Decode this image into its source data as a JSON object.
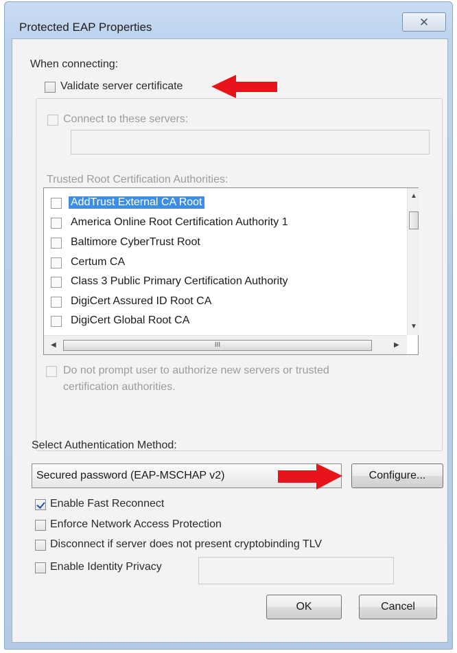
{
  "window": {
    "title": "Protected EAP Properties",
    "close_glyph": "✕"
  },
  "connecting": {
    "heading": "When connecting:",
    "validate_label": "Validate server certificate",
    "validate_checked": false,
    "connect_servers_label": "Connect to these servers:",
    "connect_servers_checked": false,
    "servers_value": ""
  },
  "trusted_root": {
    "heading": "Trusted Root Certification Authorities:",
    "items": [
      {
        "label": "AddTrust External CA Root",
        "checked": false,
        "selected": true
      },
      {
        "label": "America Online Root Certification Authority 1",
        "checked": false,
        "selected": false
      },
      {
        "label": "Baltimore CyberTrust Root",
        "checked": false,
        "selected": false
      },
      {
        "label": "Certum CA",
        "checked": false,
        "selected": false
      },
      {
        "label": "Class 3 Public Primary Certification Authority",
        "checked": false,
        "selected": false
      },
      {
        "label": "DigiCert Assured ID Root CA",
        "checked": false,
        "selected": false
      },
      {
        "label": "DigiCert Global Root CA",
        "checked": false,
        "selected": false
      }
    ],
    "hscroll_grip": "III"
  },
  "prompt": {
    "label_line1": "Do not prompt user to authorize new servers or trusted",
    "label_line2": "certification authorities.",
    "checked": false
  },
  "auth": {
    "heading": "Select Authentication Method:",
    "selected_method": "Secured password (EAP-MSCHAP v2)",
    "configure_label": "Configure..."
  },
  "options": [
    {
      "label": "Enable Fast Reconnect",
      "checked": true
    },
    {
      "label": "Enforce Network Access Protection",
      "checked": false
    },
    {
      "label": "Disconnect if server does not present cryptobinding TLV",
      "checked": false
    },
    {
      "label": "Enable Identity Privacy",
      "checked": false
    }
  ],
  "identity_value": "",
  "buttons": {
    "ok_label": "OK",
    "cancel_label": "Cancel"
  },
  "colors": {
    "annotation_arrow": "#e8141b",
    "selection": "#3a8ee6"
  }
}
